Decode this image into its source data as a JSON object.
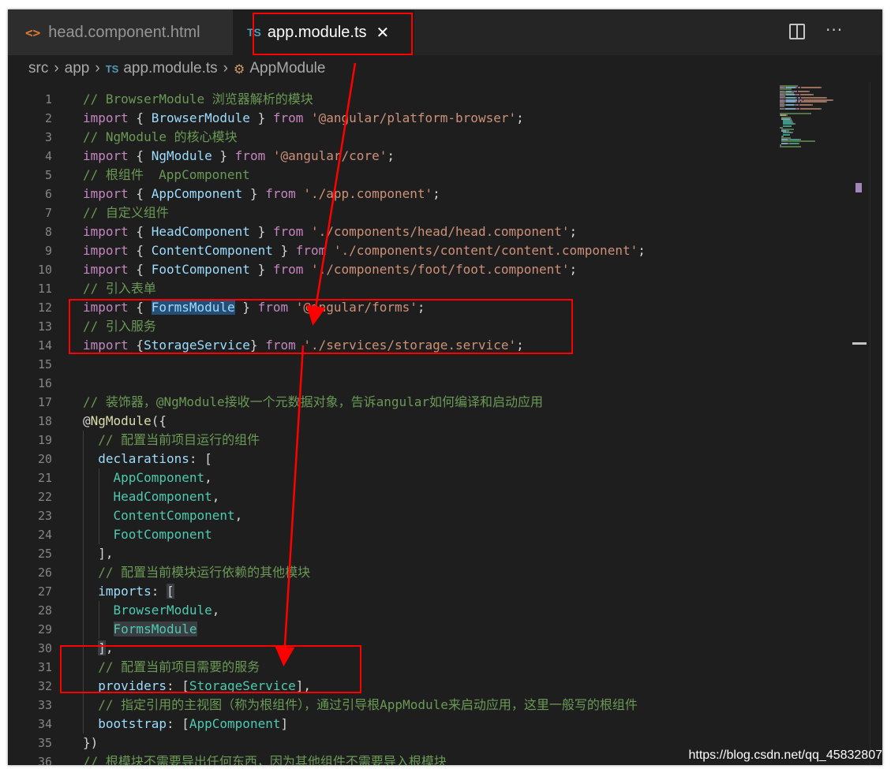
{
  "tabs": [
    {
      "icon": "<>",
      "label": "head.component.html",
      "active": false
    },
    {
      "icon": "TS",
      "label": "app.module.ts",
      "active": true,
      "close": "✕"
    }
  ],
  "toolbar": {
    "split_icon": "split-editor-icon",
    "more": "···"
  },
  "breadcrumb": [
    "src",
    "app",
    "TS",
    "app.module.ts",
    "AppModule"
  ],
  "watermark": "https://blog.csdn.net/qq_45832807",
  "colors": {
    "annotation": "#ff0000",
    "background": "#1e1e1e"
  },
  "code": [
    {
      "n": "1",
      "parts": [
        [
          "c",
          "// BrowserModule 浏览器解析的模块"
        ]
      ]
    },
    {
      "n": "2",
      "parts": [
        [
          "k",
          "import"
        ],
        [
          "p",
          " { "
        ],
        [
          "v",
          "BrowserModule"
        ],
        [
          "p",
          " } "
        ],
        [
          "k",
          "from"
        ],
        [
          "p",
          " "
        ],
        [
          "s",
          "'@angular/platform-browser'"
        ],
        [
          "p",
          ";"
        ]
      ]
    },
    {
      "n": "3",
      "parts": [
        [
          "c",
          "// NgModule 的核心模块"
        ]
      ]
    },
    {
      "n": "4",
      "parts": [
        [
          "k",
          "import"
        ],
        [
          "p",
          " { "
        ],
        [
          "v",
          "NgModule"
        ],
        [
          "p",
          " } "
        ],
        [
          "k",
          "from"
        ],
        [
          "p",
          " "
        ],
        [
          "s",
          "'@angular/core'"
        ],
        [
          "p",
          ";"
        ]
      ]
    },
    {
      "n": "5",
      "parts": [
        [
          "c",
          "// 根组件  AppComponent"
        ]
      ]
    },
    {
      "n": "6",
      "parts": [
        [
          "k",
          "import"
        ],
        [
          "p",
          " { "
        ],
        [
          "v",
          "AppComponent"
        ],
        [
          "p",
          " } "
        ],
        [
          "k",
          "from"
        ],
        [
          "p",
          " "
        ],
        [
          "s",
          "'./app.component'"
        ],
        [
          "p",
          ";"
        ]
      ]
    },
    {
      "n": "7",
      "parts": [
        [
          "c",
          "// 自定义组件"
        ]
      ]
    },
    {
      "n": "8",
      "parts": [
        [
          "k",
          "import"
        ],
        [
          "p",
          " { "
        ],
        [
          "v",
          "HeadComponent"
        ],
        [
          "p",
          " } "
        ],
        [
          "k",
          "from"
        ],
        [
          "p",
          " "
        ],
        [
          "s",
          "'./components/head/head.component'"
        ],
        [
          "p",
          ";"
        ]
      ]
    },
    {
      "n": "9",
      "parts": [
        [
          "k",
          "import"
        ],
        [
          "p",
          " { "
        ],
        [
          "v",
          "ContentComponent"
        ],
        [
          "p",
          " } "
        ],
        [
          "k",
          "from"
        ],
        [
          "p",
          " "
        ],
        [
          "s",
          "'./components/content/content.component'"
        ],
        [
          "p",
          ";"
        ]
      ]
    },
    {
      "n": "10",
      "parts": [
        [
          "k",
          "import"
        ],
        [
          "p",
          " { "
        ],
        [
          "v",
          "FootComponent"
        ],
        [
          "p",
          " } "
        ],
        [
          "k",
          "from"
        ],
        [
          "p",
          " "
        ],
        [
          "s",
          "'./components/foot/foot.component'"
        ],
        [
          "p",
          ";"
        ]
      ]
    },
    {
      "n": "11",
      "parts": [
        [
          "c",
          "// 引入表单"
        ]
      ]
    },
    {
      "n": "12",
      "parts": [
        [
          "k",
          "import"
        ],
        [
          "p",
          " { "
        ],
        [
          "v hl",
          "FormsModule"
        ],
        [
          "p",
          " } "
        ],
        [
          "k",
          "from"
        ],
        [
          "p",
          " "
        ],
        [
          "s",
          "'@angular/forms'"
        ],
        [
          "p",
          ";"
        ]
      ]
    },
    {
      "n": "13",
      "parts": [
        [
          "c",
          "// 引入服务"
        ]
      ]
    },
    {
      "n": "14",
      "parts": [
        [
          "k",
          "import"
        ],
        [
          "p",
          " {"
        ],
        [
          "v",
          "StorageService"
        ],
        [
          "p",
          "} "
        ],
        [
          "k",
          "from"
        ],
        [
          "p",
          " "
        ],
        [
          "s",
          "'./services/storage.service'"
        ],
        [
          "p",
          ";"
        ]
      ]
    },
    {
      "n": "15",
      "parts": []
    },
    {
      "n": "16",
      "parts": []
    },
    {
      "n": "17",
      "parts": [
        [
          "c",
          "// 装饰器，@NgModule接收一个元数据对象，告诉angular如何编译和启动应用"
        ]
      ]
    },
    {
      "n": "18",
      "parts": [
        [
          "p",
          "@"
        ],
        [
          "f",
          "NgModule"
        ],
        [
          "p",
          "({"
        ]
      ]
    },
    {
      "n": "19",
      "parts": [
        [
          "p",
          "  "
        ],
        [
          "c",
          "// 配置当前项目运行的组件"
        ]
      ]
    },
    {
      "n": "20",
      "parts": [
        [
          "p",
          "  "
        ],
        [
          "v",
          "declarations"
        ],
        [
          "p",
          ": ["
        ]
      ]
    },
    {
      "n": "21",
      "parts": [
        [
          "p",
          "    "
        ],
        [
          "t",
          "AppComponent"
        ],
        [
          "p",
          ","
        ]
      ]
    },
    {
      "n": "22",
      "parts": [
        [
          "p",
          "    "
        ],
        [
          "t",
          "HeadComponent"
        ],
        [
          "p",
          ","
        ]
      ]
    },
    {
      "n": "23",
      "parts": [
        [
          "p",
          "    "
        ],
        [
          "t",
          "ContentComponent"
        ],
        [
          "p",
          ","
        ]
      ]
    },
    {
      "n": "24",
      "parts": [
        [
          "p",
          "    "
        ],
        [
          "t",
          "FootComponent"
        ]
      ]
    },
    {
      "n": "25",
      "parts": [
        [
          "p",
          "  ],"
        ]
      ]
    },
    {
      "n": "26",
      "parts": [
        [
          "p",
          "  "
        ],
        [
          "c",
          "// 配置当前模块运行依赖的其他模块"
        ]
      ]
    },
    {
      "n": "27",
      "parts": [
        [
          "p",
          "  "
        ],
        [
          "v",
          "imports"
        ],
        [
          "p",
          ": "
        ],
        [
          "p hl2",
          "["
        ]
      ]
    },
    {
      "n": "28",
      "parts": [
        [
          "p",
          "    "
        ],
        [
          "t",
          "BrowserModule"
        ],
        [
          "p",
          ","
        ]
      ]
    },
    {
      "n": "29",
      "parts": [
        [
          "p",
          "    "
        ],
        [
          "t hl2",
          "FormsModule"
        ]
      ]
    },
    {
      "n": "30",
      "parts": [
        [
          "p",
          "  "
        ],
        [
          "p hl2",
          "]"
        ],
        [
          "p",
          ","
        ]
      ]
    },
    {
      "n": "31",
      "parts": [
        [
          "p",
          "  "
        ],
        [
          "c",
          "// 配置当前项目需要的服务"
        ]
      ]
    },
    {
      "n": "32",
      "parts": [
        [
          "p",
          "  "
        ],
        [
          "v",
          "providers"
        ],
        [
          "p",
          ": ["
        ],
        [
          "t",
          "StorageService"
        ],
        [
          "p",
          "],"
        ]
      ]
    },
    {
      "n": "33",
      "parts": [
        [
          "p",
          "  "
        ],
        [
          "c",
          "// 指定引用的主视图（称为根组件），通过引导根AppModule来启动应用，这里一般写的根组件"
        ]
      ]
    },
    {
      "n": "34",
      "parts": [
        [
          "p",
          "  "
        ],
        [
          "v",
          "bootstrap"
        ],
        [
          "p",
          ": ["
        ],
        [
          "t",
          "AppComponent"
        ],
        [
          "p",
          "]"
        ]
      ]
    },
    {
      "n": "35",
      "parts": [
        [
          "p",
          "})"
        ]
      ]
    },
    {
      "n": "36",
      "parts": [
        [
          "c",
          "// 根模块不需要导出任何东西，因为其他组件不需要导入根模块"
        ]
      ]
    }
  ]
}
